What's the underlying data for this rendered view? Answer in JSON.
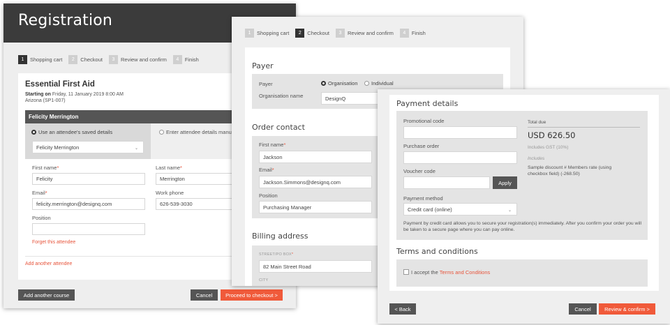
{
  "registration": {
    "title": "Registration",
    "steps": [
      {
        "num": "1",
        "label": "Shopping cart",
        "active": true
      },
      {
        "num": "2",
        "label": "Checkout",
        "active": false
      },
      {
        "num": "3",
        "label": "Review and confirm",
        "active": false
      },
      {
        "num": "4",
        "label": "Finish",
        "active": false
      }
    ],
    "course": {
      "title": "Essential First Aid",
      "starting_label": "Starting on",
      "starting_value": "Friday, 11 January 2019 8:00 AM",
      "location": "Arizona (SP1-007)"
    },
    "attendee": {
      "name": "Felicity Merrington",
      "option_saved": "Use an attendee's saved details",
      "option_enter": "Enter attendee details manu",
      "saved_select": "Felicity Merrington",
      "first_name_label": "First name",
      "first_name": "Felicity",
      "last_name_label": "Last name",
      "last_name": "Merrington",
      "email_label": "Email",
      "email": "felicity.merrington@designq.com",
      "work_phone_label": "Work phone",
      "work_phone": "626-539-3030",
      "position_label": "Position",
      "position": "",
      "forget_link": "Forget this attendee",
      "required_mark": "*"
    },
    "add_attendee_link": "Add another attendee",
    "add_course_button": "Add another course",
    "cancel_button": "Cancel",
    "proceed_button": "Proceed to checkout >"
  },
  "checkout": {
    "steps": [
      {
        "num": "1",
        "label": "Shopping cart",
        "active": false
      },
      {
        "num": "2",
        "label": "Checkout",
        "active": true
      },
      {
        "num": "3",
        "label": "Review and confirm",
        "active": false
      },
      {
        "num": "4",
        "label": "Finish",
        "active": false
      }
    ],
    "payer_title": "Payer",
    "payer_label": "Payer",
    "payer_opt_org": "Organisation",
    "payer_opt_ind": "Individual",
    "org_name_label": "Organisation name",
    "org_name": "DesignQ",
    "order_contact_title": "Order contact",
    "first_name_label": "First name",
    "first_name": "Jackson",
    "email_label": "Email",
    "email": "Jackson.Simmons@designq.com",
    "position_label": "Position",
    "position": "Purchasing Manager",
    "billing_title": "Billing address",
    "street_label": "STREET/PO BOX",
    "street": "82 Main Street Road",
    "city_label": "CITY",
    "required_mark": "*"
  },
  "payment": {
    "title": "Payment details",
    "promo_label": "Promotional code",
    "promo_value": "",
    "po_label": "Purchase order",
    "po_value": "",
    "voucher_label": "Voucher code",
    "voucher_value": "",
    "apply_button": "Apply",
    "method_label": "Payment method",
    "method_value": "Credit card (online)",
    "method_note": "Payment by credit card allows you to secure your registration(s) immediately. After you confirm your order you will be taken to a secure page where you can pay online.",
    "total_label": "Total due",
    "total_value": "USD 626.50",
    "gst_note": "Includes GST (10%)",
    "includes_label": "Includes",
    "discount_note": "Sample discount # Members rate (using checkbox field) (-268.50)",
    "terms_title": "Terms and conditions",
    "terms_prefix": "I accept the",
    "terms_link": "Terms and Conditions",
    "back_button": "< Back",
    "cancel_button": "Cancel",
    "review_button": "Review & confirm >"
  },
  "colors": {
    "accent": "#f05a3a",
    "header_dark": "#3b3b3b",
    "active_step": "#333333"
  }
}
